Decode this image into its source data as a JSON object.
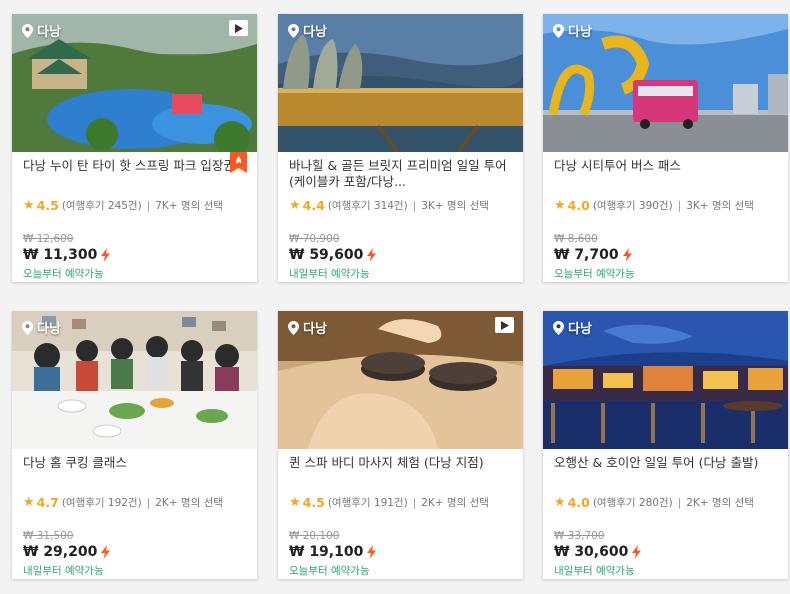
{
  "cards": [
    {
      "location": "다낭",
      "title": "다낭 누이 탄 타이 핫 스프링 파크 입장권",
      "rating": "4.5",
      "reviews": "(여행후기 245건)",
      "chosen": "7K+ 명의 선택",
      "original_price": "₩ 12,600",
      "price": "₩ 11,300",
      "availability": "오늘부터 예약가능",
      "has_video": true,
      "hot_badge": true
    },
    {
      "location": "다낭",
      "title": "바나힐 & 골든 브릿지 프리미엄 일일 투어 (케이블카 포함/다낭...",
      "rating": "4.4",
      "reviews": "(여행후기 314건)",
      "chosen": "3K+ 명의 선택",
      "original_price": "₩ 70,900",
      "price": "₩ 59,600",
      "availability": "내일부터 예약가능",
      "has_video": false,
      "hot_badge": false
    },
    {
      "location": "다낭",
      "title": "다낭 시티투어 버스 패스",
      "rating": "4.0",
      "reviews": "(여행후기 390건)",
      "chosen": "3K+ 명의 선택",
      "original_price": "₩ 8,600",
      "price": "₩ 7,700",
      "availability": "오늘부터 예약가능",
      "has_video": false,
      "hot_badge": false
    },
    {
      "location": "다낭",
      "title": "다낭 홈 쿠킹 클래스",
      "rating": "4.7",
      "reviews": "(여행후기 192건)",
      "chosen": "2K+ 명의 선택",
      "original_price": "₩ 31,500",
      "price": "₩ 29,200",
      "availability": "내일부터 예약가능",
      "has_video": false,
      "hot_badge": false
    },
    {
      "location": "다낭",
      "title": "퀸 스파 바디 마사지 체험 (다낭 지점)",
      "rating": "4.5",
      "reviews": "(여행후기 191건)",
      "chosen": "2K+ 명의 선택",
      "original_price": "₩ 20,100",
      "price": "₩ 19,100",
      "availability": "오늘부터 예약가능",
      "has_video": true,
      "hot_badge": false
    },
    {
      "location": "다낭",
      "title": "오행산 & 호이안 일일 투어 (다낭 출발)",
      "rating": "4.0",
      "reviews": "(여행후기 280건)",
      "chosen": "2K+ 명의 선택",
      "original_price": "₩ 33,700",
      "price": "₩ 30,600",
      "availability": "내일부터 예약가능",
      "has_video": false,
      "hot_badge": false
    }
  ],
  "colors": {
    "accent_orange": "#ff5722",
    "star": "#f5a623",
    "available_green": "#2aa872"
  }
}
